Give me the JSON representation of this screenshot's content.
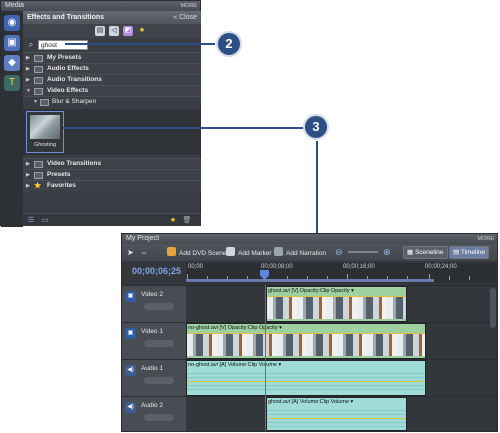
{
  "media_panel": {
    "title": "Media",
    "more_label": "MORE",
    "header_title": "Effects and Transitions",
    "close_label": "Close",
    "search": {
      "value": "ghost",
      "placeholder": ""
    },
    "tree": [
      {
        "label": "My Presets"
      },
      {
        "label": "Audio Effects"
      },
      {
        "label": "Audio Transitions"
      },
      {
        "label": "Video Effects"
      },
      {
        "label": "Blur & Sharpen"
      },
      {
        "label": "Video Transitions"
      },
      {
        "label": "Presets"
      },
      {
        "label": "Favorites"
      }
    ],
    "effect_tile": {
      "label": "Ghosting"
    }
  },
  "callouts": {
    "one": "2",
    "two": "3"
  },
  "project_panel": {
    "title": "My Project",
    "more_label": "MORE",
    "toolbar": {
      "add_dvd_scene": "Add DVD Scene",
      "add_marker": "Add Marker",
      "add_narration": "Add Narration",
      "sceneline": "Sceneline",
      "timeline": "Timeline"
    },
    "timecode": "00;00;06;25",
    "ruler_labels": [
      "00;00",
      "00;00;08;00",
      "00;00;16;00",
      "00;00;24;00"
    ],
    "tracks": {
      "video2": {
        "name": "Video 2",
        "clip_label": "ghost.avi [V] Opacity:Clip Opacity ▾"
      },
      "video1": {
        "name": "Video 1",
        "clip_label": "no-ghost.avi [V] Opacity:Clip Opacity ▾"
      },
      "audio1": {
        "name": "Audio 1",
        "clip_label": "no-ghost.avi [A] Volume:Clip Volume ▾"
      },
      "audio2": {
        "name": "Audio 2",
        "clip_label": "ghost.avi [A] Volume:Clip Volume ▾"
      }
    }
  },
  "colors": {
    "panel_bg": "#3d4046",
    "callout_blue": "#2c4f86",
    "timecode_blue": "#7da6ea",
    "video_clip": "#9fd0a0",
    "audio_clip": "#9fdcd7",
    "playhead": "#d64545"
  }
}
